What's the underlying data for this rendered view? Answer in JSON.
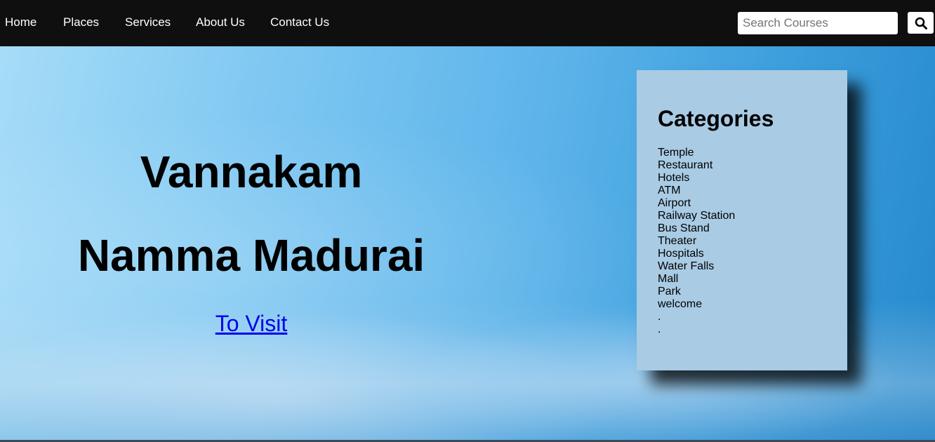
{
  "nav": {
    "items": [
      {
        "label": "Home"
      },
      {
        "label": "Places"
      },
      {
        "label": "Services"
      },
      {
        "label": "About Us"
      },
      {
        "label": "Contact Us"
      }
    ],
    "search": {
      "placeholder": "Search Courses",
      "value": "",
      "button_icon": "search-icon"
    }
  },
  "hero": {
    "line1": "Vannakam",
    "line2": "Namma Madurai",
    "link": "To Visit"
  },
  "categories": {
    "title": "Categories",
    "items": [
      "Temple",
      "Restaurant",
      "Hotels",
      "ATM",
      "Airport",
      "Railway Station",
      "Bus Stand",
      "Theater",
      "Hospitals",
      "Water Falls",
      "Mall",
      "Park",
      "welcome",
      ".",
      "."
    ]
  },
  "colors": {
    "nav_background": "#0f0f0f",
    "card_background": "#a9cbe4",
    "link": "#0000ee"
  }
}
